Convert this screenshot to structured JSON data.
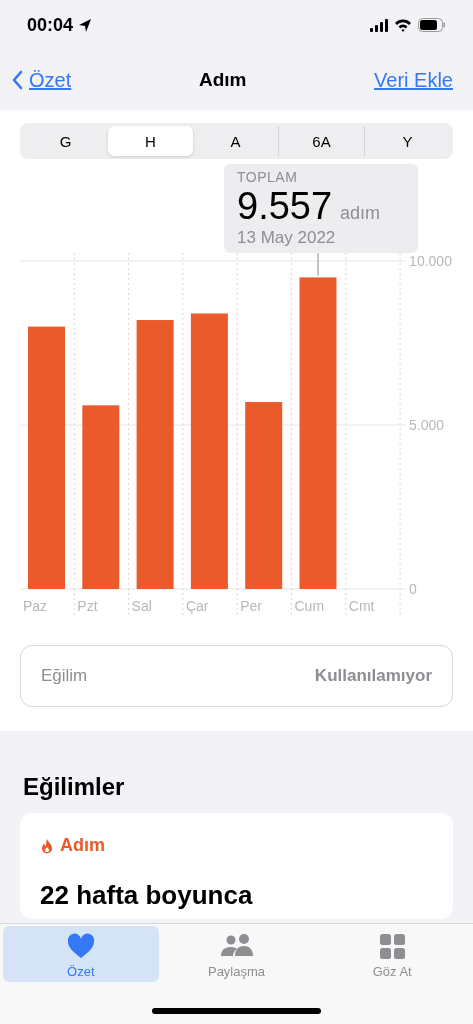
{
  "status_bar": {
    "time": "00:04"
  },
  "nav": {
    "back": "Özet",
    "title": "Adım",
    "action": "Veri Ekle"
  },
  "segments": [
    {
      "label": "G",
      "selected": false
    },
    {
      "label": "H",
      "selected": true
    },
    {
      "label": "A",
      "selected": false
    },
    {
      "label": "6A",
      "selected": false
    },
    {
      "label": "Y",
      "selected": false
    }
  ],
  "tooltip": {
    "label": "TOPLAM",
    "value": "9.557",
    "unit": "adım",
    "date": "13 May 2022"
  },
  "chart": {
    "chart_data": {
      "type": "bar",
      "categories": [
        "Paz",
        "Pzt",
        "Sal",
        "Çar",
        "Per",
        "Cum",
        "Cmt"
      ],
      "series": [
        {
          "color": "#eb5a2a",
          "values": [
            8000,
            5600,
            8200,
            8400,
            5700,
            9500,
            null
          ]
        }
      ],
      "ylim": [
        0,
        10000
      ],
      "yticks": [
        {
          "value": 0,
          "label": "0"
        },
        {
          "value": 5000,
          "label": "5.000"
        },
        {
          "value": 10000,
          "label": "10.000"
        }
      ]
    }
  },
  "trend_row": {
    "label": "Eğilim",
    "value": "Kullanılamıyor"
  },
  "trends_section": {
    "heading": "Eğilimler",
    "card": {
      "category": "Adım",
      "headline": "22 hafta boyunca"
    }
  },
  "tab_bar": [
    {
      "kind": "heart",
      "label": "Özet",
      "selected": true
    },
    {
      "kind": "people",
      "label": "Paylaşma",
      "selected": false
    },
    {
      "kind": "grid",
      "label": "Göz At",
      "selected": false
    }
  ]
}
